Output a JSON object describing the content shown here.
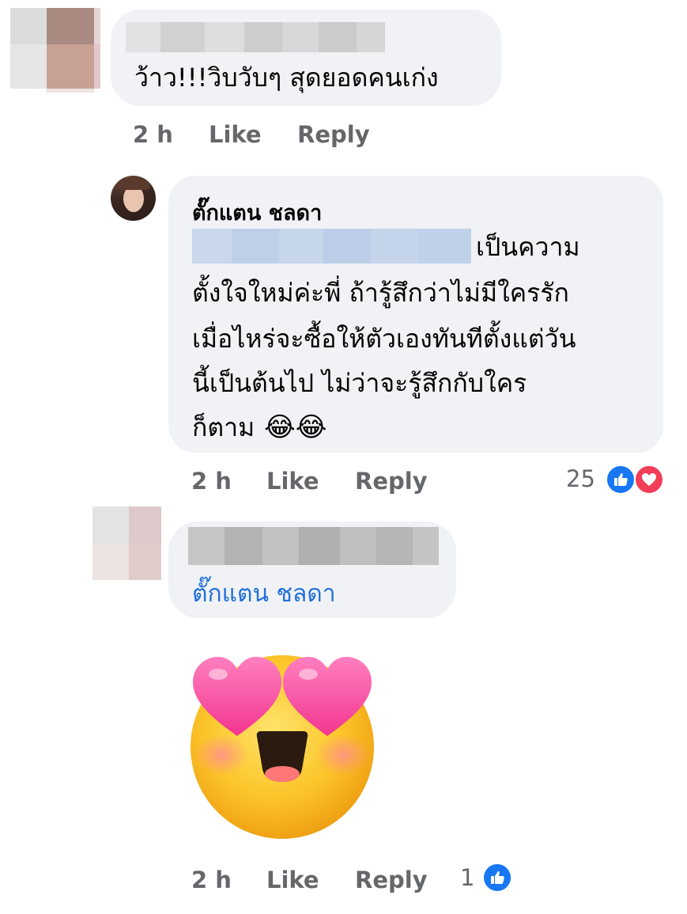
{
  "comments": [
    {
      "text": "ว้าว!!!วิบวับๆ สุดยอดคนเก่ง",
      "time": "2 h",
      "like_label": "Like",
      "reply_label": "Reply"
    },
    {
      "author": "ตั๊กแตน ชลดา",
      "text_line1_suffix": "เป็นความ",
      "text_lines": [
        "ตั้งใจใหม่ค่ะพี่ ถ้ารู้สึกว่าไม่มีใครรัก",
        "เมื่อไหร่จะซื้อให้ตัวเองทันทีตั้งแต่วัน",
        "นี้เป็นต้นไป ไม่ว่าจะรู้สึกกับใคร",
        "ก็ตาม"
      ],
      "emoji": "😂😂",
      "time": "2 h",
      "like_label": "Like",
      "reply_label": "Reply",
      "reaction_count": "25",
      "reactions": [
        "like-icon",
        "love-icon"
      ]
    },
    {
      "tag": "ตั๊กแตน ชลดา",
      "sticker": "heart-eyes-emoji",
      "time": "2 h",
      "like_label": "Like",
      "reply_label": "Reply",
      "reaction_count": "1",
      "reactions": [
        "like-icon"
      ]
    }
  ],
  "colors": {
    "bubble": "#f0f2f5",
    "meta": "#65676b",
    "tag": "#216fdb",
    "like": "#1877f2",
    "love": "#f33e58"
  }
}
